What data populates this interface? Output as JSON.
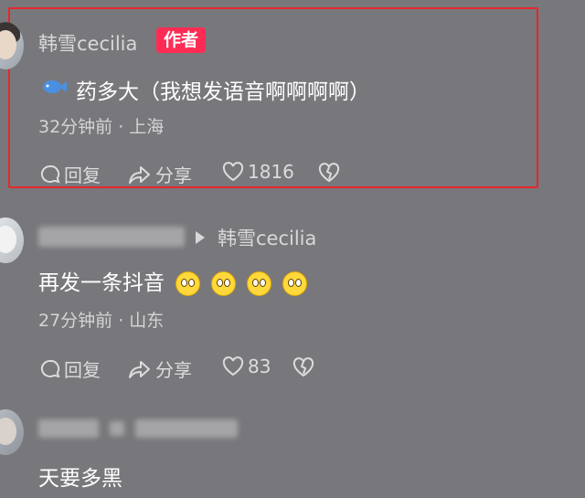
{
  "comments": [
    {
      "username": "韩雪cecilia",
      "badge": "作者",
      "text": "药多大（我想发语音啊啊啊啊）",
      "time_location": "32分钟前 · 上海",
      "actions": {
        "reply": "回复",
        "share": "分享",
        "likes": "1816"
      }
    },
    {
      "reply_to": "韩雪cecilia",
      "text": "再发一条抖音",
      "time_location": "27分钟前 · 山东",
      "actions": {
        "reply": "回复",
        "share": "分享",
        "likes": "83"
      }
    },
    {
      "text": "天要多黑"
    }
  ],
  "colors": {
    "background": "#78787c",
    "badge": "#fe2c55",
    "highlight": "#e8262a"
  },
  "icons": [
    "comment-icon",
    "share-icon",
    "heart-icon",
    "dislike-heart-icon",
    "play-triangle-icon",
    "fish-icon",
    "smiley-emoji-icon"
  ]
}
